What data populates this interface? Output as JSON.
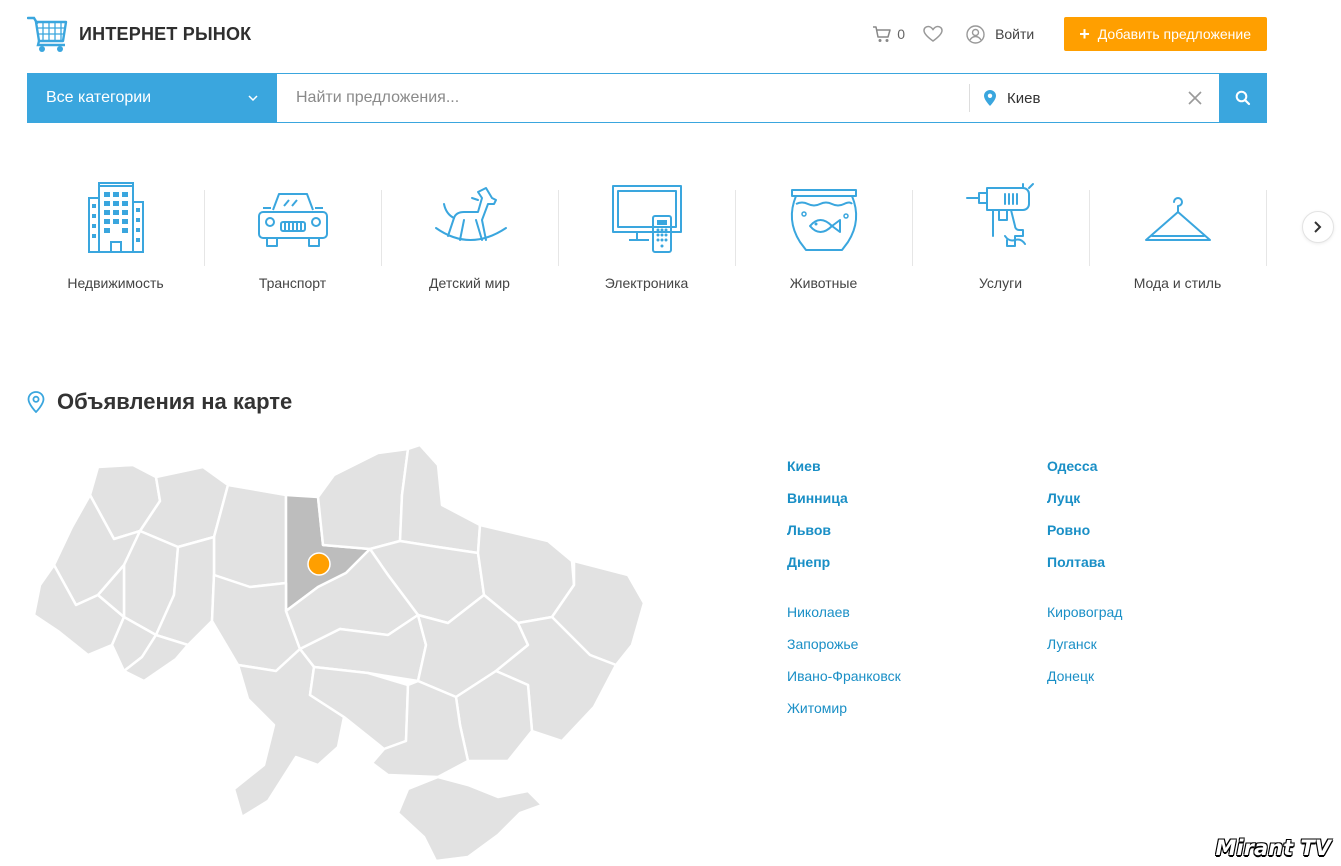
{
  "header": {
    "logo_text": "ИНТЕРНЕТ РЫНОК",
    "cart_count": "0",
    "login_label": "Войти",
    "add_button_label": "Добавить предложение"
  },
  "search": {
    "category_label": "Все категории",
    "placeholder": "Найти предложения...",
    "city_value": "Киев"
  },
  "categories": [
    {
      "label": "Недвижимость",
      "icon": "building-icon"
    },
    {
      "label": "Транспорт",
      "icon": "car-icon"
    },
    {
      "label": "Детский мир",
      "icon": "rocking-horse-icon"
    },
    {
      "label": "Электроника",
      "icon": "tv-remote-icon"
    },
    {
      "label": "Животные",
      "icon": "fishbowl-icon"
    },
    {
      "label": "Услуги",
      "icon": "drill-icon"
    },
    {
      "label": "Мода и стиль",
      "icon": "hanger-icon"
    }
  ],
  "map_section": {
    "title": "Объявления на карте"
  },
  "cities": {
    "left": {
      "top": [
        "Киев",
        "Винница",
        "Львов",
        "Днепр"
      ],
      "other": [
        "Николаев",
        "Запорожье",
        "Ивано-Франковск",
        "Житомир"
      ]
    },
    "right": {
      "top": [
        "Одесса",
        "Луцк",
        "Ровно",
        "Полтава"
      ],
      "other": [
        "Кировоград",
        "Луганск",
        "Донецк"
      ]
    }
  },
  "watermark": "Mirant TV",
  "colors": {
    "accent": "#3aa6de",
    "button": "#ff9f00",
    "link": "#1a8fc6",
    "map_region": "#e2e2e2",
    "map_selected": "#bdbdbd"
  }
}
